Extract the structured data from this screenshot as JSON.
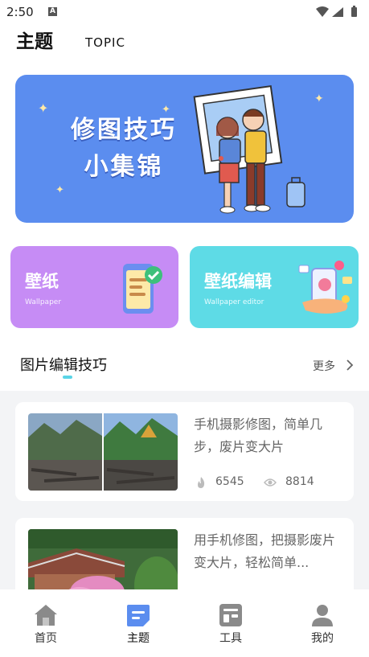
{
  "status_bar": {
    "time": "2:50",
    "a_badge": "A"
  },
  "header": {
    "title": "主题",
    "subtitle": "TOPIC"
  },
  "banner": {
    "line1": "修图技巧",
    "line2": "小集锦",
    "accent": "#5b8def"
  },
  "cards": [
    {
      "title": "壁纸",
      "subtitle": "Wallpaper",
      "color": "#c68cf5"
    },
    {
      "title": "壁纸编辑",
      "subtitle": "Wallpaper editor",
      "color": "#5edbe6"
    }
  ],
  "section": {
    "title": "图片编辑技巧",
    "more": "更多"
  },
  "articles": [
    {
      "title": "手机摄影修图，简单几步，废片变大片",
      "likes": "6545",
      "views": "8814"
    },
    {
      "title": "用手机修图，把摄影废片变大片，轻松简单..."
    }
  ],
  "tabs": [
    {
      "label": "首页",
      "icon": "home-icon"
    },
    {
      "label": "主题",
      "icon": "topic-icon",
      "active": true
    },
    {
      "label": "工具",
      "icon": "tools-icon"
    },
    {
      "label": "我的",
      "icon": "profile-icon"
    }
  ],
  "colors": {
    "active_tab": "#5b8def",
    "inactive_tab": "#8a8a8a"
  }
}
